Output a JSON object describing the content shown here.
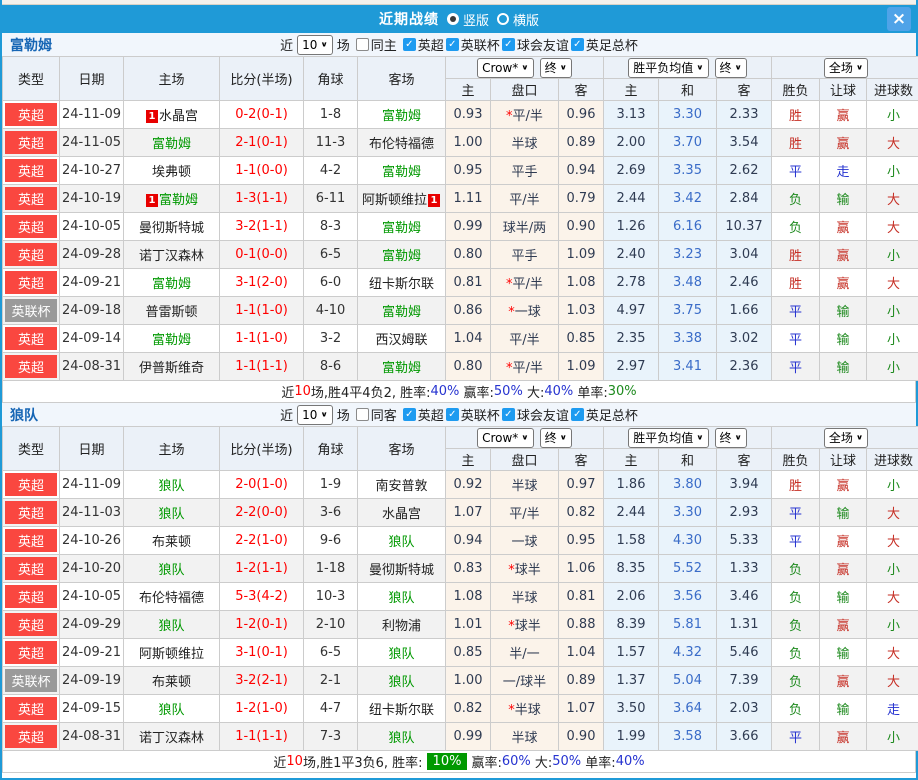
{
  "colors": {
    "titlebar": "#1F9AD7",
    "close": "#4FA3E8",
    "section-bg": "#F1F6FC",
    "head-bg": "#EBF1F8",
    "team-title": "#1766B5",
    "checkbox": "#1E9BF0",
    "badge-epl": "#FA4740",
    "badge-cup": "#9A9A9A",
    "team-green": "#009900",
    "score-red": "#FF0000",
    "cream": "#FBF3EA",
    "ltblue": "#E9F3FB",
    "odds-text": "#2F3B52",
    "mid-blue": "#3A6CC8",
    "res-red": "#C62F25",
    "res-blue": "#2633D0",
    "res-green": "#1E8A1E",
    "pct-blue": "#2633D0",
    "pct-green": "#1E8A1E",
    "sum-box": "#009900"
  },
  "titlebar": {
    "title": "近期战绩",
    "vertical": "竖版",
    "horizontal": "横版",
    "close": "×"
  },
  "table": {
    "cols": [
      "类型",
      "日期",
      "主场",
      "比分(半场)",
      "角球",
      "客场"
    ],
    "sub": [
      "主",
      "盘口",
      "客",
      "主",
      "和",
      "客",
      "胜负",
      "让球",
      "进球数"
    ],
    "selects": {
      "provider": "Crow*",
      "provider_period": "终",
      "avg": "胜平负均值",
      "avg_period": "终",
      "scope": "全场"
    }
  },
  "sections": [
    {
      "team": "富勒姆",
      "filters": {
        "near": "近",
        "count": "10",
        "games": "场",
        "same": "同主",
        "comps": [
          "英超",
          "英联杯",
          "球会友谊",
          "英足总杯"
        ]
      },
      "rows": [
        {
          "comp": "英超",
          "comp_style": "epl",
          "date": "24-11-09",
          "home": {
            "name": "水晶宫",
            "green": false,
            "card": "1"
          },
          "score": "0-2(0-1)",
          "corner": "1-8",
          "away": {
            "name": "富勒姆",
            "green": true,
            "card": null
          },
          "odds": [
            "0.93",
            "平/半",
            "0.96"
          ],
          "star": true,
          "avg": [
            "3.13",
            "3.30",
            "2.33"
          ],
          "result": [
            "胜",
            "赢",
            "小"
          ]
        },
        {
          "comp": "英超",
          "comp_style": "epl",
          "date": "24-11-05",
          "home": {
            "name": "富勒姆",
            "green": true,
            "card": null
          },
          "score": "2-1(0-1)",
          "corner": "11-3",
          "away": {
            "name": "布伦特福德",
            "green": false,
            "card": null
          },
          "odds": [
            "1.00",
            "半球",
            "0.89"
          ],
          "star": false,
          "avg": [
            "2.00",
            "3.70",
            "3.54"
          ],
          "result": [
            "胜",
            "赢",
            "大"
          ]
        },
        {
          "comp": "英超",
          "comp_style": "epl",
          "date": "24-10-27",
          "home": {
            "name": "埃弗顿",
            "green": false,
            "card": null
          },
          "score": "1-1(0-0)",
          "corner": "4-2",
          "away": {
            "name": "富勒姆",
            "green": true,
            "card": null
          },
          "odds": [
            "0.95",
            "平手",
            "0.94"
          ],
          "star": false,
          "avg": [
            "2.69",
            "3.35",
            "2.62"
          ],
          "result": [
            "平",
            "走",
            "小"
          ]
        },
        {
          "comp": "英超",
          "comp_style": "epl",
          "date": "24-10-19",
          "home": {
            "name": "富勒姆",
            "green": true,
            "card": "1"
          },
          "score": "1-3(1-1)",
          "corner": "6-11",
          "away": {
            "name": "阿斯顿维拉",
            "green": false,
            "card": "1"
          },
          "odds": [
            "1.11",
            "平/半",
            "0.79"
          ],
          "star": false,
          "avg": [
            "2.44",
            "3.42",
            "2.84"
          ],
          "result": [
            "负",
            "输",
            "大"
          ]
        },
        {
          "comp": "英超",
          "comp_style": "epl",
          "date": "24-10-05",
          "home": {
            "name": "曼彻斯特城",
            "green": false,
            "card": null
          },
          "score": "3-2(1-1)",
          "corner": "8-3",
          "away": {
            "name": "富勒姆",
            "green": true,
            "card": null
          },
          "odds": [
            "0.99",
            "球半/两",
            "0.90"
          ],
          "star": false,
          "avg": [
            "1.26",
            "6.16",
            "10.37"
          ],
          "result": [
            "负",
            "赢",
            "大"
          ]
        },
        {
          "comp": "英超",
          "comp_style": "epl",
          "date": "24-09-28",
          "home": {
            "name": "诺丁汉森林",
            "green": false,
            "card": null
          },
          "score": "0-1(0-0)",
          "corner": "6-5",
          "away": {
            "name": "富勒姆",
            "green": true,
            "card": null
          },
          "odds": [
            "0.80",
            "平手",
            "1.09"
          ],
          "star": false,
          "avg": [
            "2.40",
            "3.23",
            "3.04"
          ],
          "result": [
            "胜",
            "赢",
            "小"
          ]
        },
        {
          "comp": "英超",
          "comp_style": "epl",
          "date": "24-09-21",
          "home": {
            "name": "富勒姆",
            "green": true,
            "card": null
          },
          "score": "3-1(2-0)",
          "corner": "6-0",
          "away": {
            "name": "纽卡斯尔联",
            "green": false,
            "card": null
          },
          "odds": [
            "0.81",
            "平/半",
            "1.08"
          ],
          "star": true,
          "avg": [
            "2.78",
            "3.48",
            "2.46"
          ],
          "result": [
            "胜",
            "赢",
            "大"
          ]
        },
        {
          "comp": "英联杯",
          "comp_style": "cup",
          "date": "24-09-18",
          "home": {
            "name": "普雷斯顿",
            "green": false,
            "card": null
          },
          "score": "1-1(1-0)",
          "corner": "4-10",
          "away": {
            "name": "富勒姆",
            "green": true,
            "card": null
          },
          "odds": [
            "0.86",
            "一球",
            "1.03"
          ],
          "star": true,
          "avg": [
            "4.97",
            "3.75",
            "1.66"
          ],
          "result": [
            "平",
            "输",
            "小"
          ]
        },
        {
          "comp": "英超",
          "comp_style": "epl",
          "date": "24-09-14",
          "home": {
            "name": "富勒姆",
            "green": true,
            "card": null
          },
          "score": "1-1(1-0)",
          "corner": "3-2",
          "away": {
            "name": "西汉姆联",
            "green": false,
            "card": null
          },
          "odds": [
            "1.04",
            "平/半",
            "0.85"
          ],
          "star": false,
          "avg": [
            "2.35",
            "3.38",
            "3.02"
          ],
          "result": [
            "平",
            "输",
            "小"
          ]
        },
        {
          "comp": "英超",
          "comp_style": "epl",
          "date": "24-08-31",
          "home": {
            "name": "伊普斯维奇",
            "green": false,
            "card": null
          },
          "score": "1-1(1-1)",
          "corner": "8-6",
          "away": {
            "name": "富勒姆",
            "green": true,
            "card": null
          },
          "odds": [
            "0.80",
            "平/半",
            "1.09"
          ],
          "star": true,
          "avg": [
            "2.97",
            "3.41",
            "2.36"
          ],
          "result": [
            "平",
            "输",
            "小"
          ]
        }
      ],
      "summary": [
        {
          "text": "近",
          "style": "plain"
        },
        {
          "text": "10",
          "style": "red"
        },
        {
          "text": "场,胜4平4负2, 胜率:",
          "style": "plain"
        },
        {
          "text": "40%",
          "style": "blue"
        },
        {
          "text": " 赢率:",
          "style": "plain"
        },
        {
          "text": "50%",
          "style": "blue"
        },
        {
          "text": " 大:",
          "style": "plain"
        },
        {
          "text": "40%",
          "style": "blue"
        },
        {
          "text": " 单率:",
          "style": "plain"
        },
        {
          "text": "30%",
          "style": "green"
        }
      ]
    },
    {
      "team": "狼队",
      "filters": {
        "near": "近",
        "count": "10",
        "games": "场",
        "same": "同客",
        "comps": [
          "英超",
          "英联杯",
          "球会友谊",
          "英足总杯"
        ]
      },
      "rows": [
        {
          "comp": "英超",
          "comp_style": "epl",
          "date": "24-11-09",
          "home": {
            "name": "狼队",
            "green": true,
            "card": null
          },
          "score": "2-0(1-0)",
          "corner": "1-9",
          "away": {
            "name": "南安普敦",
            "green": false,
            "card": null
          },
          "odds": [
            "0.92",
            "半球",
            "0.97"
          ],
          "star": false,
          "avg": [
            "1.86",
            "3.80",
            "3.94"
          ],
          "result": [
            "胜",
            "赢",
            "小"
          ]
        },
        {
          "comp": "英超",
          "comp_style": "epl",
          "date": "24-11-03",
          "home": {
            "name": "狼队",
            "green": true,
            "card": null
          },
          "score": "2-2(0-0)",
          "corner": "3-6",
          "away": {
            "name": "水晶宫",
            "green": false,
            "card": null
          },
          "odds": [
            "1.07",
            "平/半",
            "0.82"
          ],
          "star": false,
          "avg": [
            "2.44",
            "3.30",
            "2.93"
          ],
          "result": [
            "平",
            "输",
            "大"
          ]
        },
        {
          "comp": "英超",
          "comp_style": "epl",
          "date": "24-10-26",
          "home": {
            "name": "布莱顿",
            "green": false,
            "card": null
          },
          "score": "2-2(1-0)",
          "corner": "9-6",
          "away": {
            "name": "狼队",
            "green": true,
            "card": null
          },
          "odds": [
            "0.94",
            "一球",
            "0.95"
          ],
          "star": false,
          "avg": [
            "1.58",
            "4.30",
            "5.33"
          ],
          "result": [
            "平",
            "赢",
            "大"
          ]
        },
        {
          "comp": "英超",
          "comp_style": "epl",
          "date": "24-10-20",
          "home": {
            "name": "狼队",
            "green": true,
            "card": null
          },
          "score": "1-2(1-1)",
          "corner": "1-18",
          "away": {
            "name": "曼彻斯特城",
            "green": false,
            "card": null
          },
          "odds": [
            "0.83",
            "球半",
            "1.06"
          ],
          "star": true,
          "avg": [
            "8.35",
            "5.52",
            "1.33"
          ],
          "result": [
            "负",
            "赢",
            "小"
          ]
        },
        {
          "comp": "英超",
          "comp_style": "epl",
          "date": "24-10-05",
          "home": {
            "name": "布伦特福德",
            "green": false,
            "card": null
          },
          "score": "5-3(4-2)",
          "corner": "10-3",
          "away": {
            "name": "狼队",
            "green": true,
            "card": null
          },
          "odds": [
            "1.08",
            "半球",
            "0.81"
          ],
          "star": false,
          "avg": [
            "2.06",
            "3.56",
            "3.46"
          ],
          "result": [
            "负",
            "输",
            "大"
          ]
        },
        {
          "comp": "英超",
          "comp_style": "epl",
          "date": "24-09-29",
          "home": {
            "name": "狼队",
            "green": true,
            "card": null
          },
          "score": "1-2(0-1)",
          "corner": "2-10",
          "away": {
            "name": "利物浦",
            "green": false,
            "card": null
          },
          "odds": [
            "1.01",
            "球半",
            "0.88"
          ],
          "star": true,
          "avg": [
            "8.39",
            "5.81",
            "1.31"
          ],
          "result": [
            "负",
            "赢",
            "小"
          ]
        },
        {
          "comp": "英超",
          "comp_style": "epl",
          "date": "24-09-21",
          "home": {
            "name": "阿斯顿维拉",
            "green": false,
            "card": null
          },
          "score": "3-1(0-1)",
          "corner": "6-5",
          "away": {
            "name": "狼队",
            "green": true,
            "card": null
          },
          "odds": [
            "0.85",
            "半/一",
            "1.04"
          ],
          "star": false,
          "avg": [
            "1.57",
            "4.32",
            "5.46"
          ],
          "result": [
            "负",
            "输",
            "大"
          ]
        },
        {
          "comp": "英联杯",
          "comp_style": "cup",
          "date": "24-09-19",
          "home": {
            "name": "布莱顿",
            "green": false,
            "card": null
          },
          "score": "3-2(2-1)",
          "corner": "2-1",
          "away": {
            "name": "狼队",
            "green": true,
            "card": null
          },
          "odds": [
            "1.00",
            "一/球半",
            "0.89"
          ],
          "star": false,
          "avg": [
            "1.37",
            "5.04",
            "7.39"
          ],
          "result": [
            "负",
            "赢",
            "大"
          ]
        },
        {
          "comp": "英超",
          "comp_style": "epl",
          "date": "24-09-15",
          "home": {
            "name": "狼队",
            "green": true,
            "card": null
          },
          "score": "1-2(1-0)",
          "corner": "4-7",
          "away": {
            "name": "纽卡斯尔联",
            "green": false,
            "card": null
          },
          "odds": [
            "0.82",
            "半球",
            "1.07"
          ],
          "star": true,
          "avg": [
            "3.50",
            "3.64",
            "2.03"
          ],
          "result": [
            "负",
            "输",
            "走"
          ]
        },
        {
          "comp": "英超",
          "comp_style": "epl",
          "date": "24-08-31",
          "home": {
            "name": "诺丁汉森林",
            "green": false,
            "card": null
          },
          "score": "1-1(1-1)",
          "corner": "7-3",
          "away": {
            "name": "狼队",
            "green": true,
            "card": null
          },
          "odds": [
            "0.99",
            "半球",
            "0.90"
          ],
          "star": false,
          "avg": [
            "1.99",
            "3.58",
            "3.66"
          ],
          "result": [
            "平",
            "赢",
            "小"
          ]
        }
      ],
      "summary": [
        {
          "text": "近",
          "style": "plain"
        },
        {
          "text": "10",
          "style": "red"
        },
        {
          "text": "场,胜1平3负6, 胜率:",
          "style": "plain"
        },
        {
          "text": "10%",
          "style": "greenbox"
        },
        {
          "text": "赢率:",
          "style": "plain"
        },
        {
          "text": "60%",
          "style": "blue"
        },
        {
          "text": " 大:",
          "style": "plain"
        },
        {
          "text": "50%",
          "style": "blue"
        },
        {
          "text": " 单率:",
          "style": "plain"
        },
        {
          "text": "40%",
          "style": "blue"
        }
      ]
    }
  ]
}
